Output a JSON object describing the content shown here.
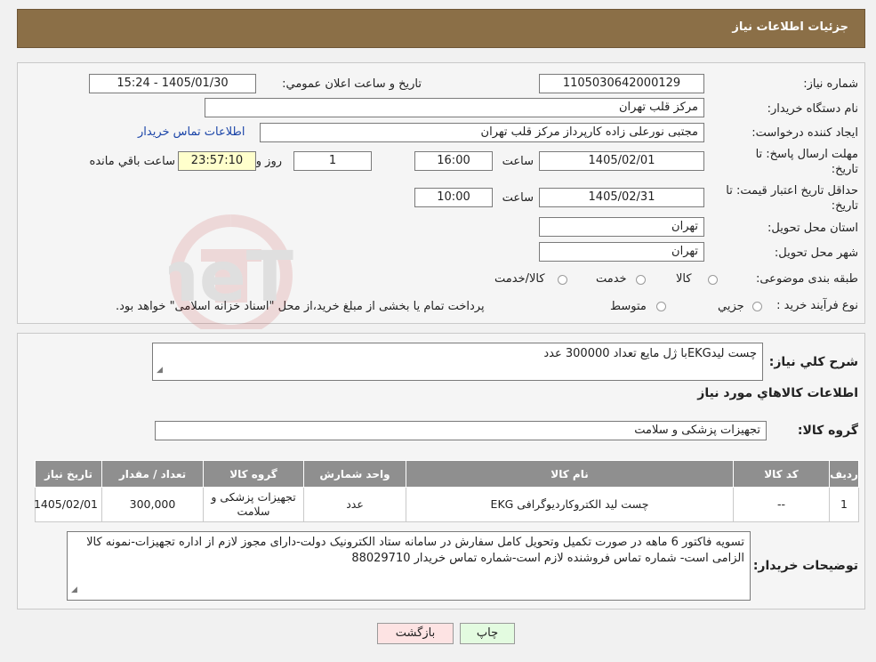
{
  "header": {
    "title": "جزئیات اطلاعات نیاز"
  },
  "form": {
    "need_number_label": "شماره نیاز:",
    "need_number": "1105030642000129",
    "announce_label": "تاريخ و ساعت اعلان عمومي:",
    "announce_value": "1405/01/30 - 15:24",
    "buyer_org_label": "نام دستگاه خريدار:",
    "buyer_org": "مرکز قلب تهران",
    "requester_label": "ایجاد کننده درخواست:",
    "requester": "مجتبی نورعلی زاده کارپرداز مرکز قلب تهران",
    "contact_link": "اطلاعات تماس خريدار",
    "deadline_label_1": "مهلت ارسال پاسخ: تا",
    "deadline_label_2": "تاريخ:",
    "deadline_date": "1405/02/01",
    "time_label": "ساعت",
    "deadline_time": "16:00",
    "days_value": "1",
    "days_label": "روز و",
    "remaining_time": "23:57:10",
    "remaining_label": "ساعت باقي مانده",
    "validity_label_1": "حداقل تاريخ اعتبار قيمت: تا",
    "validity_label_2": "تاريخ:",
    "validity_date": "1405/02/31",
    "validity_time_label": "ساعت",
    "validity_time": "10:00",
    "province_label": "استان محل تحويل:",
    "province": "تهران",
    "city_label": "شهر محل تحويل:",
    "city": "تهران",
    "category_label": "طبقه بندی موضوعی:",
    "category_options": [
      "کالا",
      "خدمت",
      "کالا/خدمت"
    ],
    "process_label": "نوع فرآيند خريد :",
    "process_options": [
      "جزيي",
      "متوسط"
    ],
    "process_note": "پرداخت تمام یا بخشی از مبلغ خرید،از محل \"اسناد خزانه اسلامی\" خواهد بود."
  },
  "details": {
    "summary_label": "شرح کلي نياز:",
    "summary": "چست لیدEKGبا ژل مایع تعداد 300000 عدد",
    "items_heading": "اطلاعات کالاهاي مورد نياز",
    "group_label": "گروه کالا:",
    "group": "تجهیزات پزشکی و سلامت",
    "table": {
      "headers": [
        "رديف",
        "کد کالا",
        "نام کالا",
        "واحد شمارش",
        "گروه کالا",
        "تعداد / مقدار",
        "تاريخ نياز"
      ],
      "rows": [
        [
          "1",
          "--",
          "چست لید الکتروکاردیوگرافی EKG",
          "عدد",
          "تجهیزات پزشکی و سلامت",
          "300,000",
          "1405/02/01"
        ]
      ]
    },
    "buyer_notes_label": "توضيحات خريدار:",
    "buyer_notes": "تسویه فاکتور 6 ماهه در صورت تکمیل وتحویل کامل سفارش در سامانه  ستاد الکترونیک دولت-دارای مجوز لازم از اداره تجهیزات-نمونه کالا الزامی است- شماره تماس فروشنده لازم است-شماره تماس خریدار 88029710"
  },
  "buttons": {
    "print": "چاپ",
    "back": "بازگشت"
  },
  "watermark_text": "AriaTender.neT",
  "colors": {
    "header": "#8b6f47",
    "table_header": "#8f8f8f",
    "back_button": "#fde3e3",
    "print_button": "#e3fbe0"
  }
}
